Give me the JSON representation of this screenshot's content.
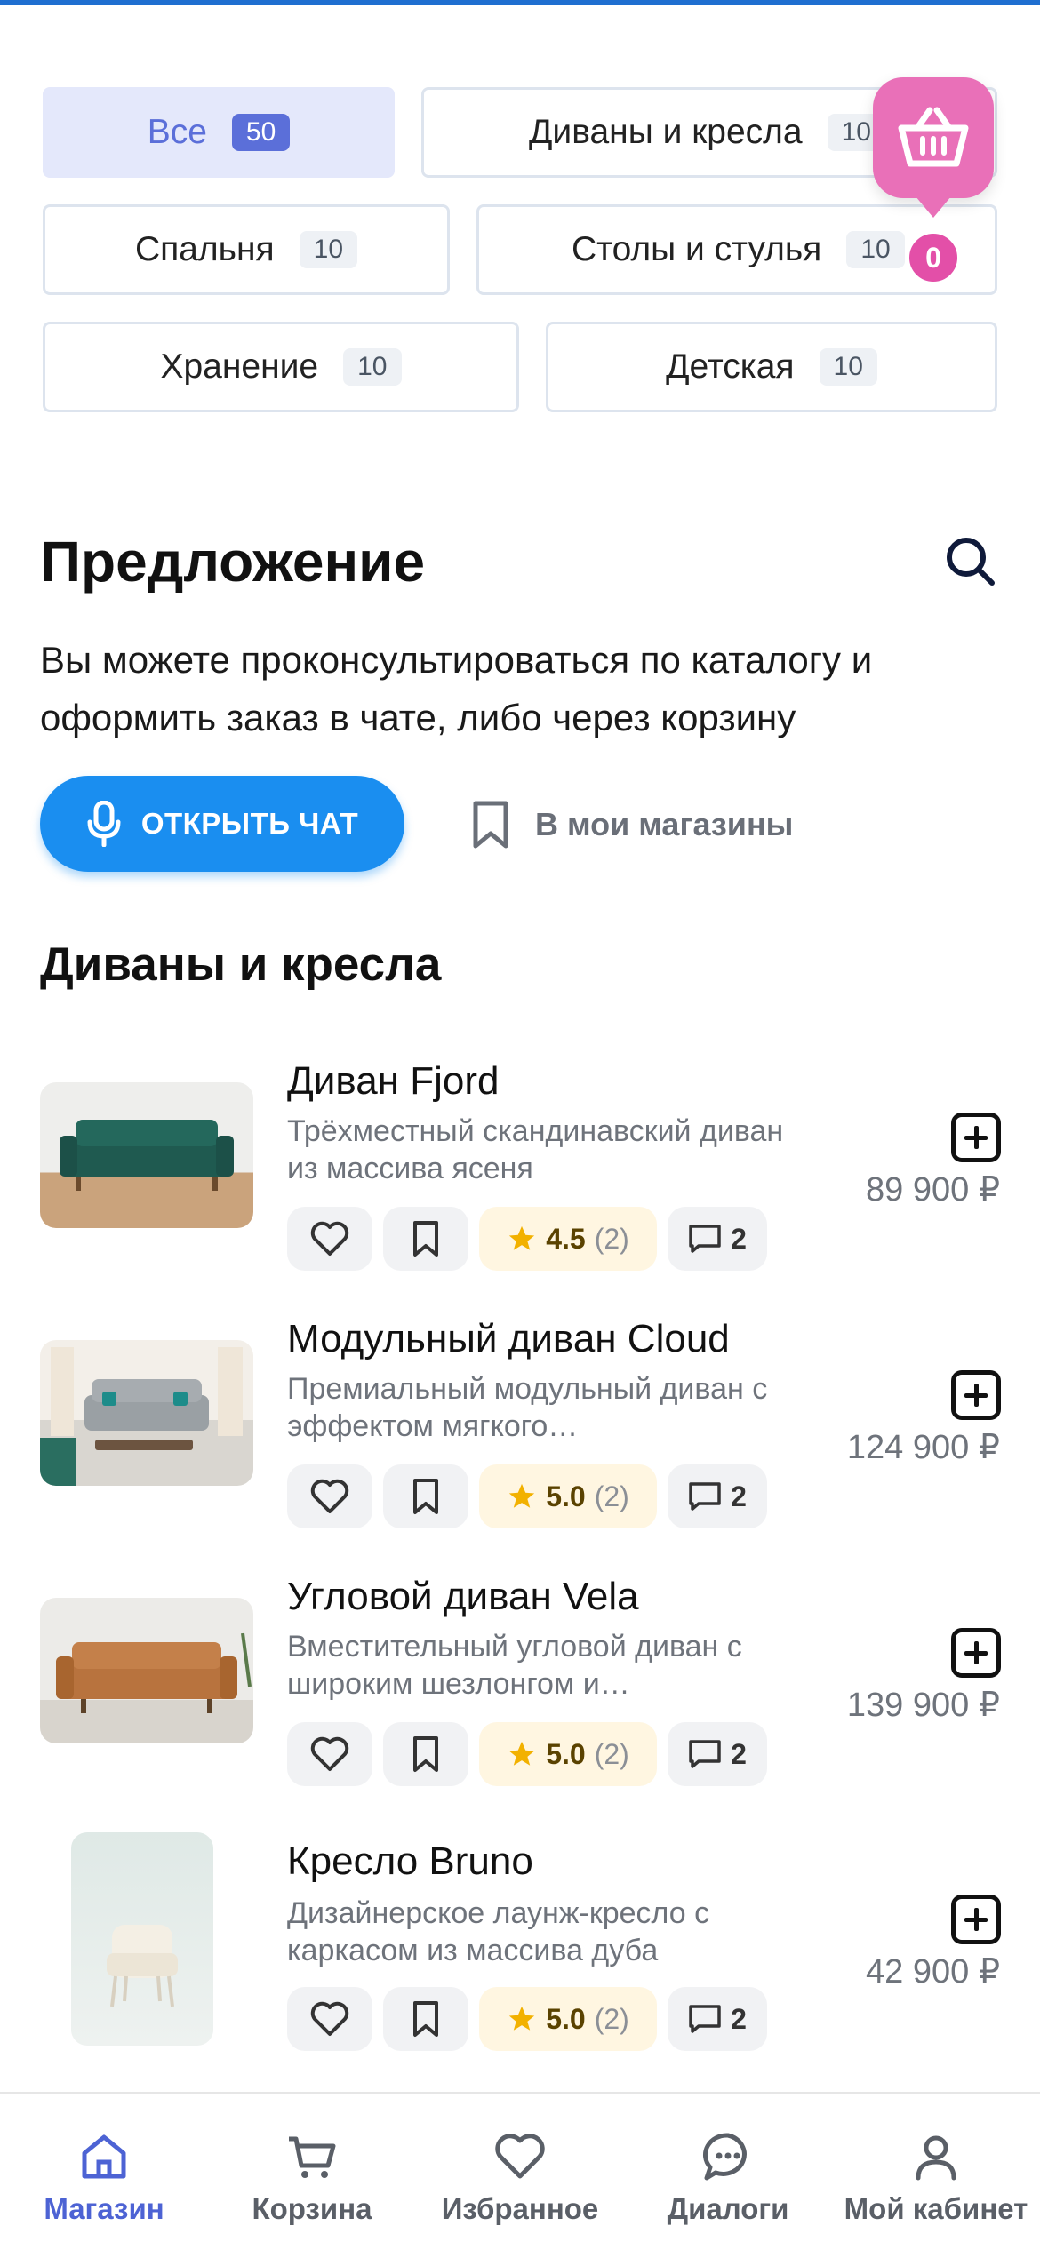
{
  "categories": [
    {
      "label": "Все",
      "count": "50",
      "active": true
    },
    {
      "label": "Диваны и кресла",
      "count": "10"
    },
    {
      "label": "Спальня",
      "count": "10"
    },
    {
      "label": "Столы и стулья",
      "count": "10"
    },
    {
      "label": "Хранение",
      "count": "10"
    },
    {
      "label": "Детская",
      "count": "10"
    }
  ],
  "cart": {
    "count": "0",
    "icon": "basket-icon",
    "color": "#e970b8"
  },
  "offer": {
    "title": "Предложение",
    "description": "Вы можете проконсультироваться по каталогу и оформить заказ в чате, либо через корзину",
    "open_chat_label": "ОТКРЫТЬ ЧАТ",
    "my_shops_label": "В мои магазины"
  },
  "section_heading": "Диваны и кресла",
  "products": [
    {
      "name": "Диван Fjord",
      "description": "Трёхместный скандинавский диван из массива ясеня",
      "price": "89 900 ₽",
      "rating": "4.5",
      "reviews": "(2)",
      "comments": "2"
    },
    {
      "name": "Модульный диван Cloud",
      "description": "Премиальный модульный диван с эффектом мягкого…",
      "price": "124 900 ₽",
      "rating": "5.0",
      "reviews": "(2)",
      "comments": "2"
    },
    {
      "name": "Угловой диван Vela",
      "description": "Вместительный угловой диван с широким шезлонгом и…",
      "price": "139 900 ₽",
      "rating": "5.0",
      "reviews": "(2)",
      "comments": "2"
    },
    {
      "name": "Кресло Bruno",
      "description": "Дизайнерское лаунж-кресло с каркасом из массива дуба",
      "price": "42 900 ₽",
      "rating": "5.0",
      "reviews": "(2)",
      "comments": "2"
    }
  ],
  "nav": [
    {
      "label": "Магазин",
      "icon": "home-icon",
      "active": true
    },
    {
      "label": "Корзина",
      "icon": "cart-icon"
    },
    {
      "label": "Избранное",
      "icon": "heart-icon"
    },
    {
      "label": "Диалоги",
      "icon": "chat-icon"
    },
    {
      "label": "Мой кабинет",
      "icon": "user-icon"
    }
  ],
  "colors": {
    "accent": "#1a8ef0",
    "active_nav": "#4d63d4",
    "cart": "#e970b8"
  }
}
